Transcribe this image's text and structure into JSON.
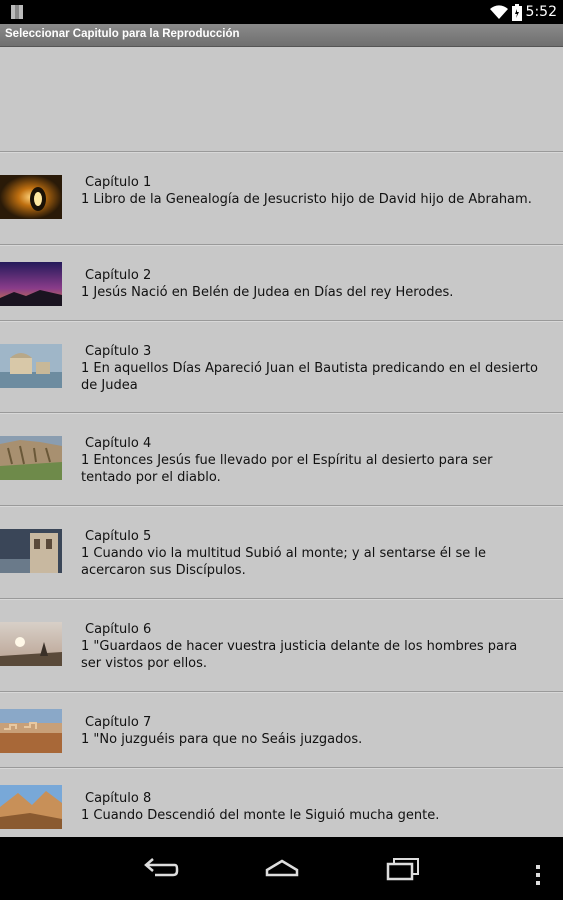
{
  "status_bar": {
    "time": "5:52",
    "icons": [
      "notification-icon",
      "wifi-icon",
      "battery-icon"
    ]
  },
  "title_bar": {
    "title": "Seleccionar Capitulo para la Reproducción"
  },
  "chapters": [
    {
      "title": "Capítulo 1",
      "desc": " 1 Libro de la Genealogía de Jesucristo  hijo de David  hijo de Abraham.",
      "thumb": "tunnel-light-image"
    },
    {
      "title": "Capítulo 2",
      "desc": " 1 Jesús Nació en Belén de Judea  en Días del rey Herodes.",
      "thumb": "night-sky-image"
    },
    {
      "title": "Capítulo 3",
      "desc": " 1 En aquellos Días Apareció Juan el Bautista predicando en el desierto de Judea",
      "thumb": "coastal-town-image"
    },
    {
      "title": "Capítulo 4",
      "desc": " 1 Entonces Jesús fue llevado por el Espíritu al desierto  para ser tentado por el diablo.",
      "thumb": "rock-cliff-image"
    },
    {
      "title": "Capítulo 5",
      "desc": " 1 Cuando vio la multitud  Subió al monte; y al sentarse él  se le acercaron sus Discípulos.",
      "thumb": "building-image"
    },
    {
      "title": "Capítulo 6",
      "desc": " 1 \"Guardaos de hacer vuestra justicia delante de los hombres  para ser vistos por ellos.",
      "thumb": "sunrise-image"
    },
    {
      "title": "Capítulo 7",
      "desc": " 1 \"No juzguéis  para que no Seáis juzgados.",
      "thumb": "desert-city-image"
    },
    {
      "title": "Capítulo 8",
      "desc": " 1 Cuando Descendió del monte  le Siguió mucha gente.",
      "thumb": "mountain-image"
    }
  ],
  "nav_bar": {
    "icons": [
      "back-icon",
      "home-icon",
      "recent-apps-icon",
      "menu-icon"
    ]
  }
}
